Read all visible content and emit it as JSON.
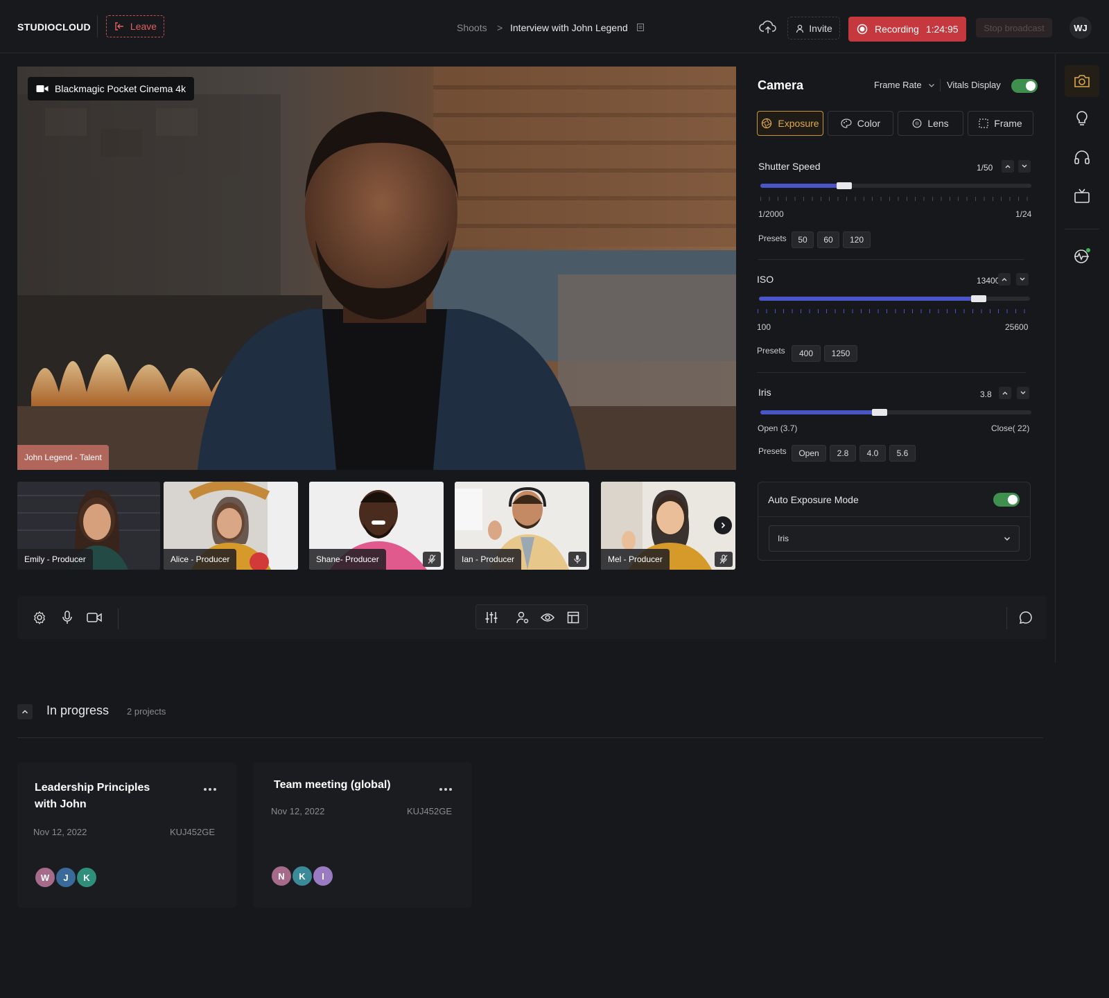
{
  "app": {
    "logo": "STUDIOCLOUD",
    "leave_label": "Leave",
    "user_initials": "WJ"
  },
  "breadcrumb": {
    "root": "Shoots",
    "separator": ">",
    "current": "Interview with John Legend"
  },
  "header": {
    "invite_label": "Invite",
    "recording_label": "Recording",
    "recording_time": "1:24:95",
    "stop_broadcast_label": "Stop broadcast"
  },
  "video": {
    "camera_name": "Blackmagic Pocket Cinema 4k",
    "talent_label": "John Legend - Talent"
  },
  "participants": [
    {
      "label": "Emily - Producer",
      "mic": "none"
    },
    {
      "label": "Alice - Producer",
      "mic": "none"
    },
    {
      "label": "Shane- Producer",
      "mic": "muted"
    },
    {
      "label": "Ian - Producer",
      "mic": "on"
    },
    {
      "label": "Mel - Producer",
      "mic": "muted"
    }
  ],
  "camera_panel": {
    "title": "Camera",
    "frame_rate_label": "Frame Rate",
    "vitals_label": "Vitals Display",
    "vitals_on": true,
    "tabs": [
      {
        "label": "Exposure",
        "icon": "aperture-icon",
        "active": true
      },
      {
        "label": "Color",
        "icon": "palette-icon",
        "active": false
      },
      {
        "label": "Lens",
        "icon": "lens-icon",
        "active": false
      },
      {
        "label": "Frame",
        "icon": "frame-icon",
        "active": false
      }
    ],
    "shutter": {
      "label": "Shutter Speed",
      "value": "1/50",
      "min_label": "1/2000",
      "max_label": "1/24",
      "level": 0.31,
      "presets_label": "Presets",
      "presets": [
        "50",
        "60",
        "120"
      ]
    },
    "iso": {
      "label": "ISO",
      "value": "13400",
      "min_label": "100",
      "max_label": "25600",
      "level": 0.81,
      "presets_label": "Presets",
      "presets": [
        "400",
        "1250"
      ]
    },
    "iris": {
      "label": "Iris",
      "value": "3.8",
      "min_label": "Open (3.7)",
      "max_label": "Close( 22)",
      "level": 0.44,
      "presets_label": "Presets",
      "presets": [
        "Open",
        "2.8",
        "4.0",
        "5.6"
      ]
    },
    "auto_exposure": {
      "label": "Auto Exposure Mode",
      "on": true,
      "selected": "Iris"
    }
  },
  "projects": {
    "section_title": "In progress",
    "count_label": "2 projects",
    "cards": [
      {
        "title_line1": "Leadership Principles",
        "title_line2": "with John",
        "date": "Nov 12, 2022",
        "code": "KUJ452GE",
        "avatars": [
          "W",
          "J",
          "K"
        ]
      },
      {
        "title_line1": "Team meeting (global)",
        "title_line2": "",
        "date": "Nov 12, 2022",
        "code": "KUJ452GE",
        "avatars": [
          "N",
          "K",
          "I"
        ]
      }
    ]
  },
  "colors": {
    "accent": "#c8943a",
    "record_red": "#c5383d",
    "slider_blue": "#4a55c8",
    "toggle_green": "#3f8f4f",
    "background": "#17181b"
  }
}
